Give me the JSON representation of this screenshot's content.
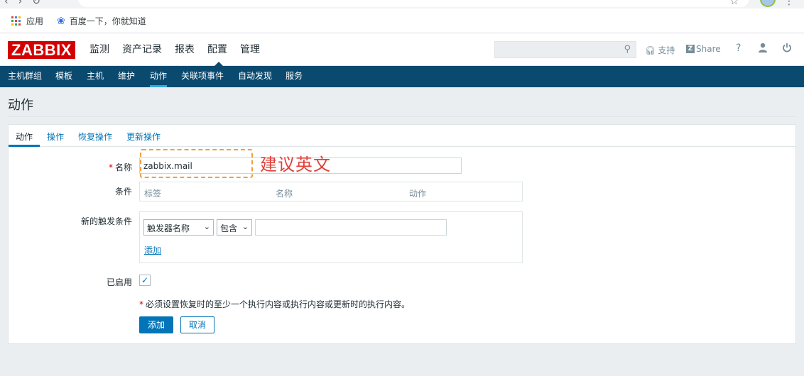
{
  "bookmarks": [
    {
      "label": "应用",
      "icon": "apps-grid-icon"
    },
    {
      "label": "百度一下，你就知道",
      "icon": "baidu-paw-icon"
    }
  ],
  "header": {
    "logo": "ZABBIX",
    "menu": [
      "监测",
      "资产记录",
      "报表",
      "配置",
      "管理"
    ],
    "active_menu": "配置",
    "support": "支持",
    "share": "Share",
    "help": "?"
  },
  "subnav": [
    "主机群组",
    "模板",
    "主机",
    "维护",
    "动作",
    "关联项事件",
    "自动发现",
    "服务"
  ],
  "page_title": "动作",
  "tabs": [
    "动作",
    "操作",
    "恢复操作",
    "更新操作"
  ],
  "form": {
    "name_label": "名称",
    "name_required_mark": "*",
    "name_value": "zabbix.mail",
    "conditions_label": "条件",
    "conditions_columns": [
      "标签",
      "名称",
      "动作"
    ],
    "new_condition_label": "新的触发条件",
    "condition_type": "触发器名称",
    "condition_operator": "包含",
    "condition_value": "",
    "add_link": "添加",
    "enabled_label": "已启用",
    "enabled": true,
    "note_mark": "*",
    "note": "必须设置恢复时的至少一个执行内容或执行内容或更新时的执行内容。",
    "submit": "添加",
    "cancel": "取消"
  },
  "annotation": "建议英文",
  "colors": {
    "brand_red": "#d40000",
    "nav_blue": "#0b4a6f",
    "link_blue": "#0275b8",
    "annotation_orange": "#f0a040",
    "annotation_red": "#e0403a"
  }
}
